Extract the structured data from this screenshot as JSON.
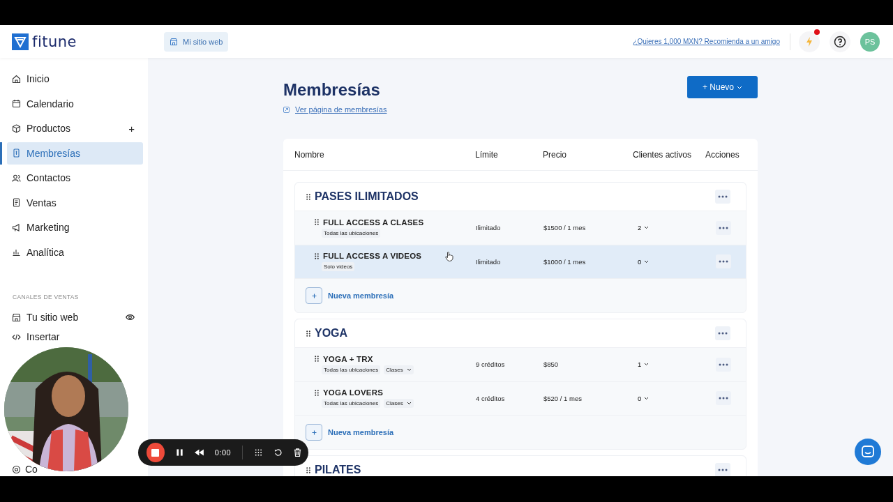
{
  "header": {
    "logo": "fitune",
    "site_button": "Mi sitio web",
    "referral_link": "¿Quieres 1,000 MXN? Recomienda a un amigo",
    "notification": true,
    "avatar": "PS"
  },
  "sidebar": {
    "items": [
      {
        "label": "Inicio",
        "selected": false
      },
      {
        "label": "Calendario",
        "selected": false
      },
      {
        "label": "Productos",
        "selected": false,
        "add": "+"
      },
      {
        "label": "Membresías",
        "selected": true
      },
      {
        "label": "Contactos",
        "selected": false
      },
      {
        "label": "Ventas",
        "selected": false
      },
      {
        "label": "Marketing",
        "selected": false
      },
      {
        "label": "Analítica",
        "selected": false
      }
    ],
    "section_title": "CANALES DE VENTAS",
    "channel_items": [
      {
        "label": "Tu sitio web"
      },
      {
        "label": "Insertar"
      },
      {
        "label": "Co"
      }
    ]
  },
  "page": {
    "title": "Membresías",
    "new_button": "+ Nuevo",
    "view_link": "Ver página de membresías"
  },
  "table": {
    "columns": [
      "Nombre",
      "Límite",
      "Precio",
      "Clientes activos",
      "Acciones"
    ],
    "groups": [
      {
        "name": "PASES ILIMITADOS",
        "add_label": "Nueva membresía",
        "rows": [
          {
            "name": "FULL ACCESS A CLASES",
            "tags": [
              {
                "label": "Todas las ubicaciones",
                "kind": "plain"
              }
            ],
            "limit": "Ilimitado",
            "price": "$1500 / 1 mes",
            "active_clients": "2",
            "highlighted": false
          },
          {
            "name": "FULL ACCESS A VIDEOS",
            "tags": [
              {
                "label": "Solo videos",
                "kind": "plain"
              }
            ],
            "limit": "Ilimitado",
            "price": "$1000 / 1 mes",
            "active_clients": "0",
            "highlighted": true
          }
        ]
      },
      {
        "name": "YOGA",
        "add_label": "Nueva membresía",
        "rows": [
          {
            "name": "YOGA + TRX",
            "tags": [
              {
                "label": "Todas las ubicaciones",
                "kind": "plain"
              },
              {
                "label": "Clases",
                "kind": "dropdown"
              }
            ],
            "limit": "9 créditos",
            "price": "$850",
            "active_clients": "1",
            "highlighted": false
          },
          {
            "name": "YOGA LOVERS",
            "tags": [
              {
                "label": "Todas las ubicaciones",
                "kind": "plain"
              },
              {
                "label": "Clases",
                "kind": "dropdown"
              }
            ],
            "limit": "4 créditos",
            "price": "$520 / 1 mes",
            "active_clients": "0",
            "highlighted": false
          }
        ]
      },
      {
        "name": "PILATES"
      }
    ]
  },
  "recorder": {
    "time": "0:00"
  }
}
